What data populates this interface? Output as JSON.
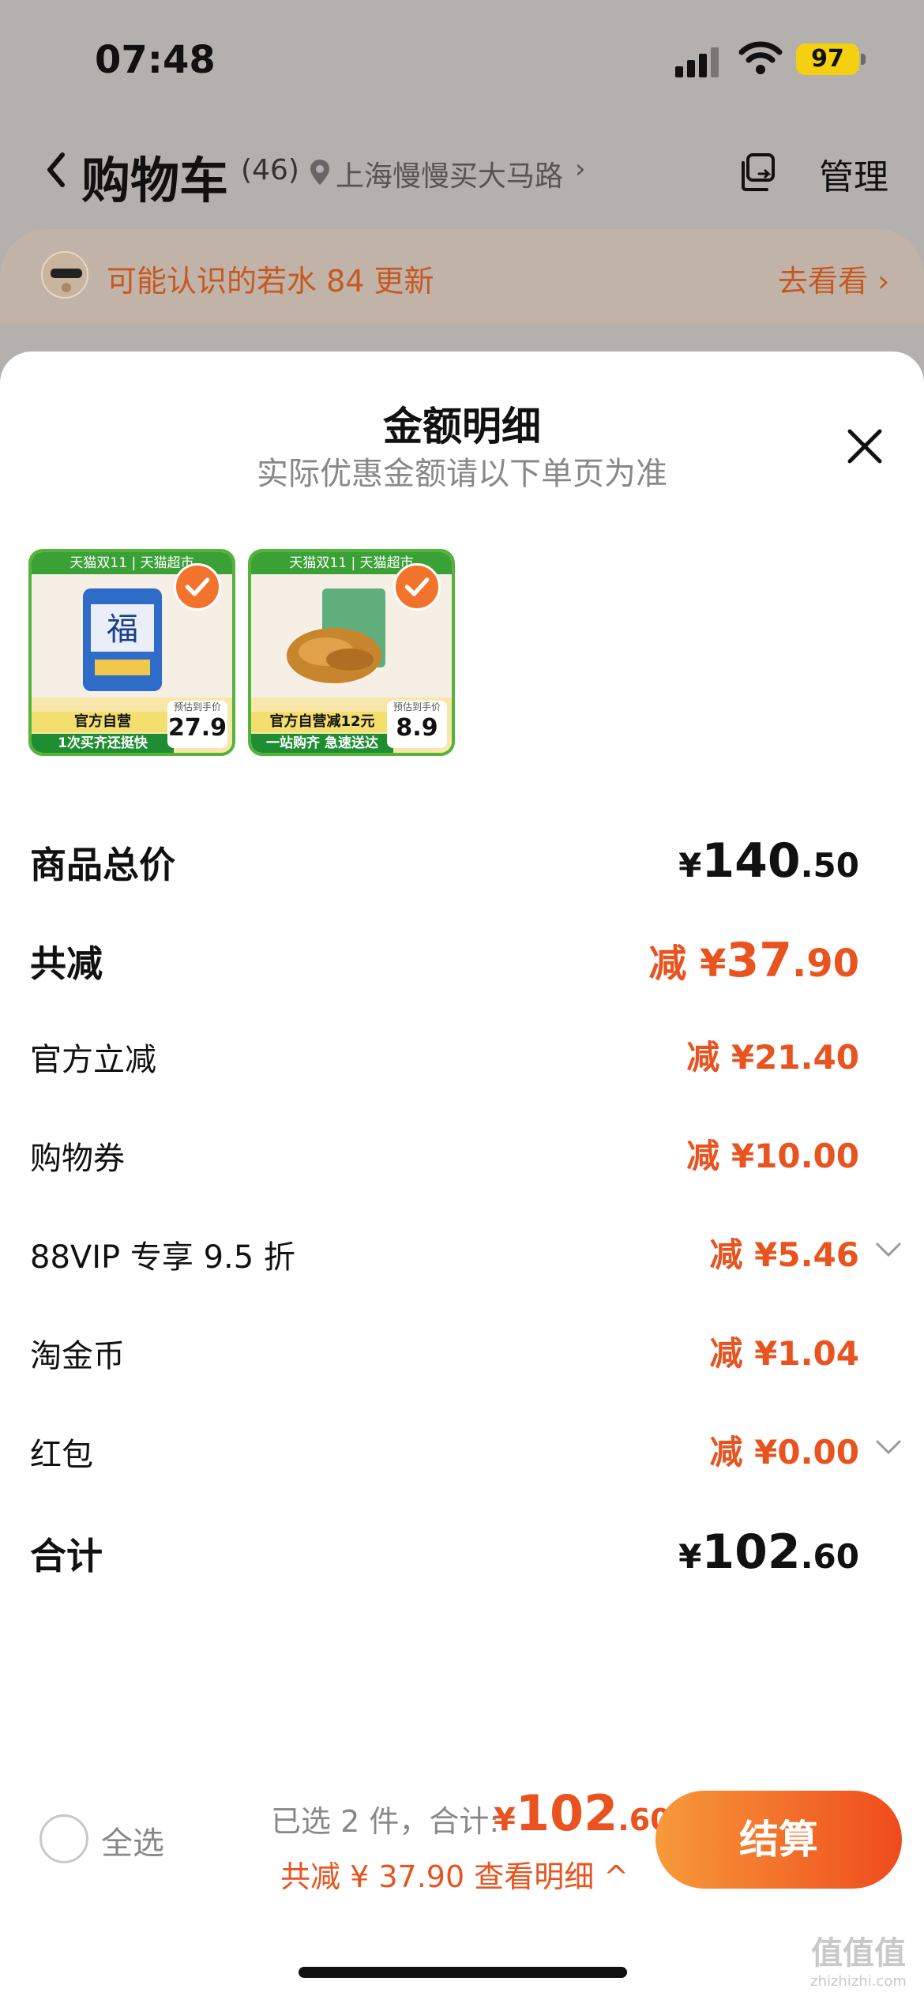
{
  "status_bar": {
    "time": "07:48",
    "battery": "97"
  },
  "header": {
    "title": "购物车",
    "count": "(46)",
    "location": "上海慢慢买大马路",
    "location_arrow": "›",
    "manage": "管理"
  },
  "friend_banner": {
    "text": "可能认识的若水 84 更新",
    "link": "去看看 ›"
  },
  "sheet": {
    "title": "金额明细",
    "subtitle": "实际优惠金额请以下单页为准"
  },
  "products": [
    {
      "top_label": "天猫双11 | 天猫超市",
      "tag": "官方自营",
      "slogan": "1次买齐还挺快",
      "price_caption": "预估到手价",
      "price": "27.9"
    },
    {
      "top_label": "天猫双11 | 天猫超市",
      "tag": "官方自营减12元",
      "slogan": "一站购齐 急速送达",
      "price_caption": "预估到手价",
      "price": "8.9"
    }
  ],
  "breakdown": {
    "total_goods": {
      "label": "商品总价",
      "yen": "¥",
      "int": "140",
      "dec": ".50"
    },
    "total_reduce": {
      "label": "共减",
      "prefix": "减 ¥",
      "int": "37",
      "dec": ".90"
    },
    "items": [
      {
        "label": "官方立减",
        "prefix": "减 ¥",
        "int": "21",
        "dec": ".40"
      },
      {
        "label": "购物券",
        "prefix": "减 ¥",
        "int": "10",
        "dec": ".00"
      },
      {
        "label": "88VIP 专享 9.5 折",
        "prefix": "减 ¥",
        "int": "5",
        "dec": ".46"
      },
      {
        "label": "淘金币",
        "prefix": "减 ¥",
        "int": "1",
        "dec": ".04"
      },
      {
        "label": "红包",
        "prefix": "减 ¥",
        "int": "0",
        "dec": ".00"
      }
    ],
    "sum": {
      "label": "合计",
      "yen": "¥",
      "int": "102",
      "dec": ".60"
    }
  },
  "footer": {
    "select_all": "全选",
    "selected_text": "已选 2 件，合计:",
    "price_yen": "¥",
    "price_int": "102",
    "price_dec": ".60",
    "reduce_text": "共减 ¥ 37.90  查看明细 ^",
    "checkout": "结算"
  },
  "watermark": {
    "text": "值值值",
    "sub": "zhizhizhi.com"
  },
  "colors": {
    "accent": "#e8531f",
    "green": "#3aa136",
    "checkout_start": "#f79a3a",
    "checkout_end": "#ef4b1d"
  }
}
